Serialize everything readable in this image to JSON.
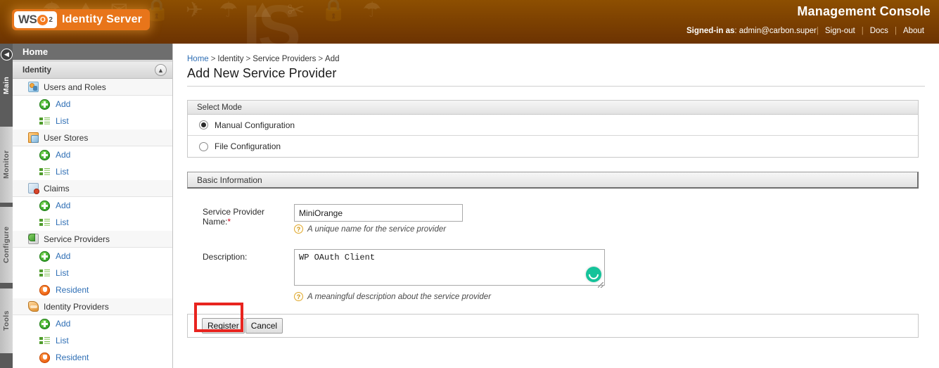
{
  "header": {
    "logo_ws": "WS",
    "logo_o": "O",
    "logo_sub": "2",
    "product_name": "Identity Server",
    "console_title": "Management Console",
    "signed_in_label": "Signed-in as",
    "signed_in_user": "admin@carbon.super",
    "sign_out": "Sign-out",
    "docs": "Docs",
    "about": "About",
    "separator": "|",
    "accent_color": "#e8751a",
    "bar_color": "#7e4201"
  },
  "vtabs": {
    "collapse_icon": "chevron-left-icon",
    "items": [
      {
        "label": "Main",
        "active": true
      },
      {
        "label": "Monitor",
        "active": false
      },
      {
        "label": "Configure",
        "active": false
      },
      {
        "label": "Tools",
        "active": false
      }
    ]
  },
  "sidebar": {
    "home_label": "Home",
    "section_label": "Identity",
    "collapse_icon": "chevron-up-icon",
    "groups": [
      {
        "label": "Users and Roles",
        "icon": "users-and-roles-icon",
        "items": [
          {
            "label": "Add",
            "icon": "add-icon"
          },
          {
            "label": "List",
            "icon": "list-icon"
          }
        ]
      },
      {
        "label": "User Stores",
        "icon": "user-stores-icon",
        "items": [
          {
            "label": "Add",
            "icon": "add-icon"
          },
          {
            "label": "List",
            "icon": "list-icon"
          }
        ]
      },
      {
        "label": "Claims",
        "icon": "claims-icon",
        "items": [
          {
            "label": "Add",
            "icon": "add-icon"
          },
          {
            "label": "List",
            "icon": "list-icon"
          }
        ]
      },
      {
        "label": "Service Providers",
        "icon": "service-providers-icon",
        "items": [
          {
            "label": "Add",
            "icon": "add-icon"
          },
          {
            "label": "List",
            "icon": "list-icon"
          },
          {
            "label": "Resident",
            "icon": "resident-icon"
          }
        ]
      },
      {
        "label": "Identity Providers",
        "icon": "identity-providers-icon",
        "items": [
          {
            "label": "Add",
            "icon": "add-icon"
          },
          {
            "label": "List",
            "icon": "list-icon"
          },
          {
            "label": "Resident",
            "icon": "resident-icon"
          }
        ]
      }
    ]
  },
  "main": {
    "breadcrumb": [
      "Home",
      "Identity",
      "Service Providers",
      "Add"
    ],
    "breadcrumb_separator": ">",
    "page_title": "Add New Service Provider",
    "select_mode": {
      "panel_title": "Select Mode",
      "options": [
        {
          "label": "Manual Configuration",
          "checked": true
        },
        {
          "label": "File Configuration",
          "checked": false
        }
      ]
    },
    "basic_information": {
      "panel_title": "Basic Information",
      "name_label": "Service Provider Name:",
      "name_required_mark": "*",
      "name_value": "MiniOrange",
      "name_hint": "A unique name for the service provider",
      "description_label": "Description:",
      "description_value": "WP OAuth Client",
      "description_hint": "A meaningful description about the service provider",
      "help_icon": "question-mark-icon",
      "grammarly_icon": "grammarly-icon",
      "resize_icon": "resize-grip-icon"
    },
    "actions": {
      "register_label": "Register",
      "cancel_label": "Cancel",
      "highlight_color": "#e8241f",
      "highlight_target": "register-button"
    }
  }
}
